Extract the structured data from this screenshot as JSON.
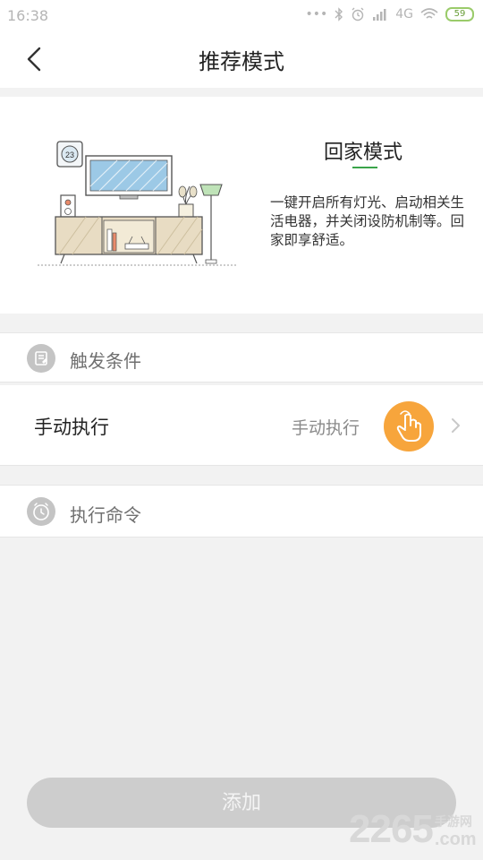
{
  "status_bar": {
    "time": "16:38",
    "dots": "•••",
    "network": "4G",
    "battery": "59"
  },
  "nav": {
    "title": "推荐模式"
  },
  "mode": {
    "title": "回家模式",
    "description": "一键开启所有灯光、启动相关生活电器，并关闭设防机制等。回家即享舒适。",
    "illustration_text": "23"
  },
  "trigger_section": {
    "label": "触发条件",
    "icon": "note-icon"
  },
  "manual_row": {
    "title": "手动执行",
    "value": "手动执行",
    "icon": "hand-tap-icon"
  },
  "command_section": {
    "label": "执行命令",
    "icon": "clock-icon"
  },
  "add_button": {
    "label": "添加"
  },
  "watermark": {
    "number": "2265",
    "site_cn": "手游网",
    "site_en": ".com"
  },
  "colors": {
    "accent_orange": "#f7a53c",
    "accent_green": "#3aa44a",
    "button_disabled": "#cdcdcd",
    "background": "#f2f2f2"
  }
}
